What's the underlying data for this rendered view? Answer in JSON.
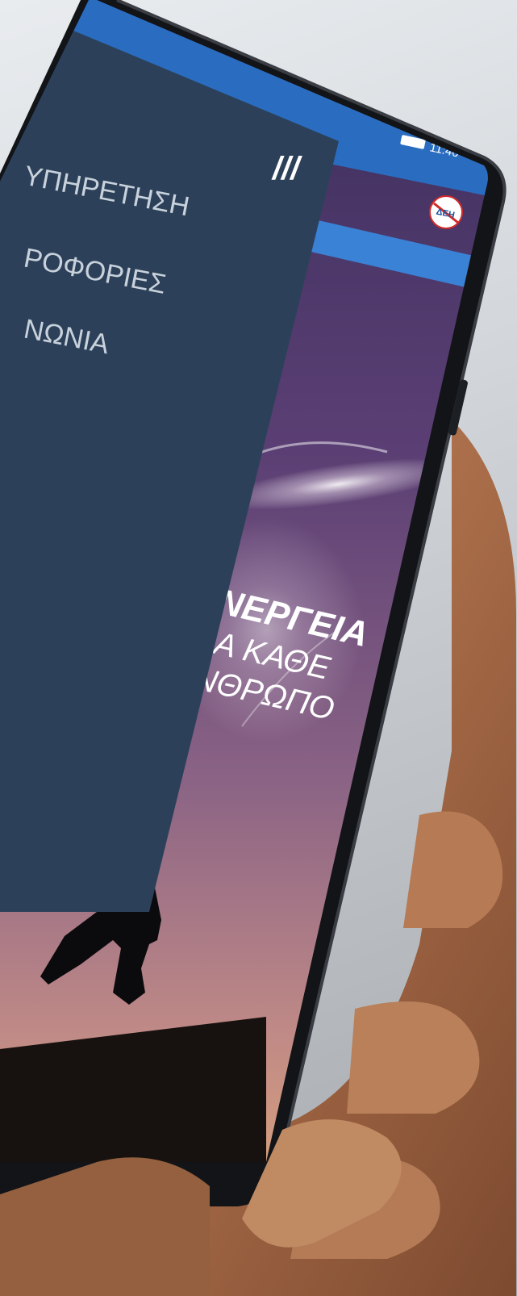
{
  "status_bar": {
    "time": "11:46"
  },
  "menu": {
    "items": [
      {
        "label": "ΥΠΗΡΕΤΗΣΗ"
      },
      {
        "label": "ΡΟΦΟΡΙΕΣ"
      },
      {
        "label": "ΝΩΝΙΑ"
      }
    ],
    "close_glyph": "///"
  },
  "header": {
    "logo_text": "ΔΕΗ"
  },
  "hero": {
    "line1": "ΕΝΕΡΓΕΙΑ",
    "line2": "ΓΙΑ ΚΑΘΕ",
    "line3": "ΑΝΘΡΩΠΟ"
  },
  "colors": {
    "menu_bg": "#2c4159",
    "header_blue": "#2a6dc0",
    "header_blue_light": "#3a82d6",
    "phone_body": "#121417"
  }
}
